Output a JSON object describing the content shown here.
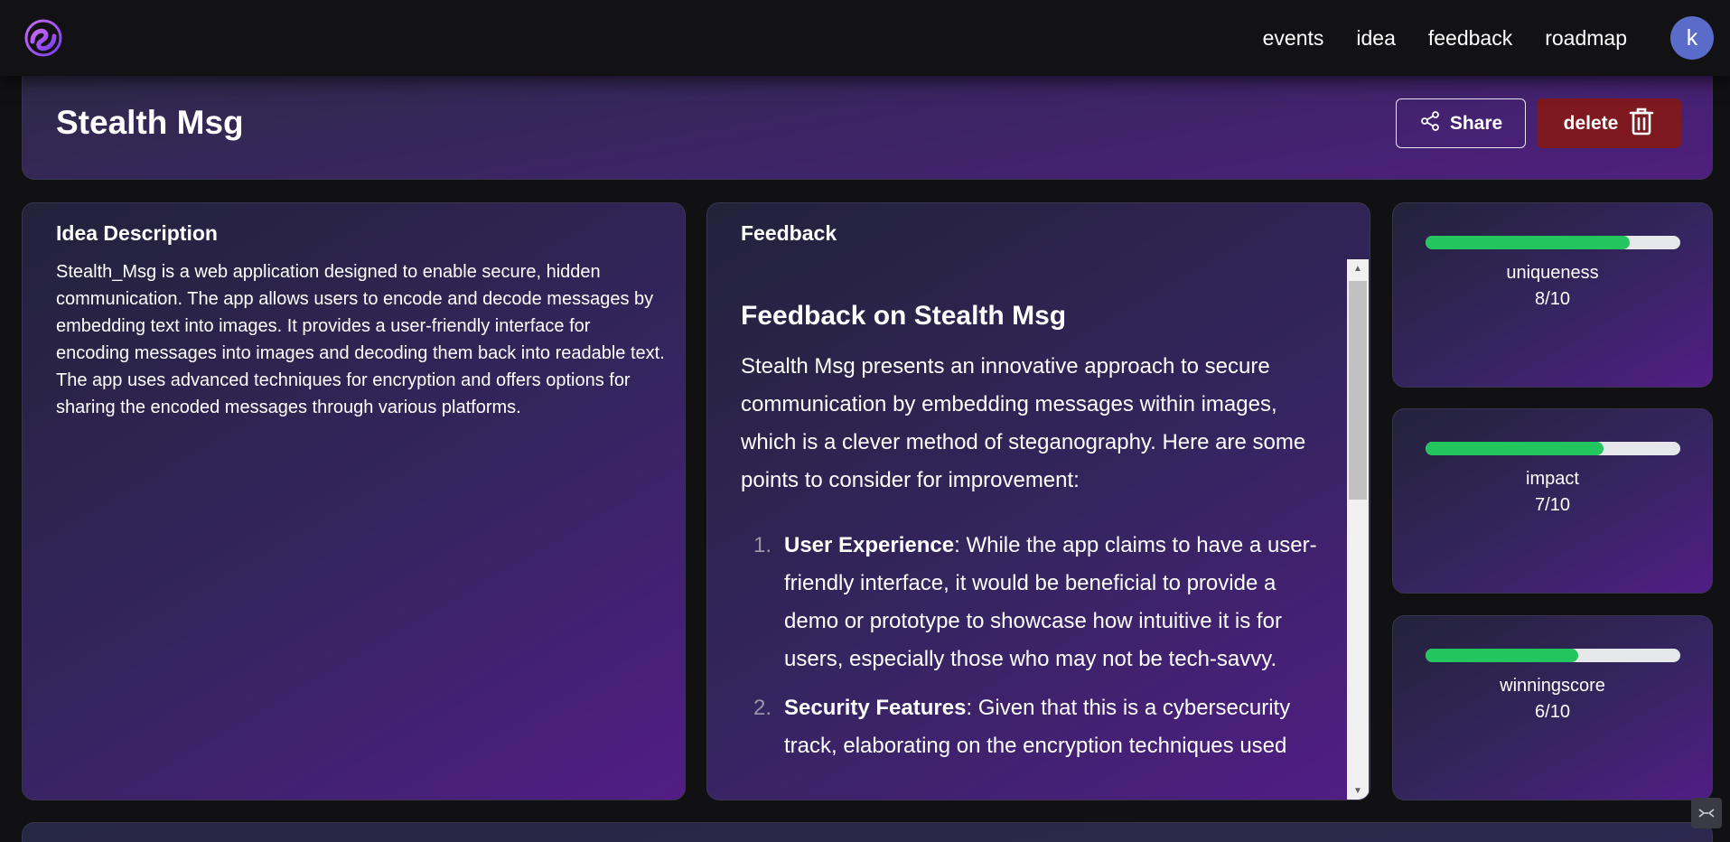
{
  "nav": {
    "links": [
      "events",
      "idea",
      "feedback",
      "roadmap"
    ],
    "avatar_initial": "k"
  },
  "header": {
    "title": "Stealth Msg",
    "share_label": "Share",
    "delete_label": "delete"
  },
  "description": {
    "heading": "Idea Description",
    "text": "Stealth_Msg is a web application designed to enable secure, hidden communication. The app allows users to encode and decode messages by embedding text into images. It provides a user-friendly interface for encoding messages into images and decoding them back into readable text. The app uses advanced techniques for encryption and offers options for sharing the encoded messages through various platforms."
  },
  "feedback": {
    "heading": "Feedback",
    "title": "Feedback on Stealth Msg",
    "intro": "Stealth Msg presents an innovative approach to secure communication by embedding messages within images, which is a clever method of steganography. Here are some points to consider for improvement:",
    "items": [
      {
        "number": "1.",
        "title": "User Experience",
        "text": ": While the app claims to have a user-friendly interface, it would be beneficial to provide a demo or prototype to showcase how intuitive it is for users, especially those who may not be tech-savvy."
      },
      {
        "number": "2.",
        "title": "Security Features",
        "text": ": Given that this is a cybersecurity track, elaborating on the encryption techniques used"
      }
    ]
  },
  "scores": [
    {
      "label": "uniqueness",
      "value": "8/10",
      "fraction": 0.8
    },
    {
      "label": "impact",
      "value": "7/10",
      "fraction": 0.7
    },
    {
      "label": "winningscore",
      "value": "6/10",
      "fraction": 0.6
    }
  ],
  "colors": {
    "accent_green": "#22c55e",
    "delete_red": "#7e1a1f",
    "avatar_blue": "#5b6bc9"
  },
  "icons": {
    "logo": "app-logo",
    "share": "share-icon",
    "delete": "trash-icon",
    "corner": "collapse-icon"
  }
}
